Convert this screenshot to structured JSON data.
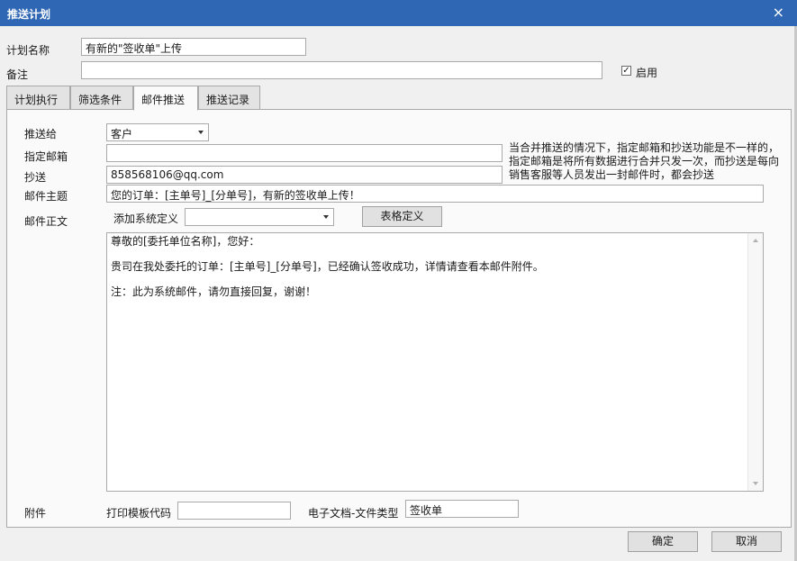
{
  "window": {
    "title": "推送计划",
    "close": "×"
  },
  "plan_name": {
    "label": "计划名称",
    "value": "有新的\"签收单\"上传"
  },
  "remark": {
    "label": "备注",
    "value": ""
  },
  "enable": {
    "label": "启用",
    "checked": true,
    "check_glyph": "✓"
  },
  "tabs": [
    {
      "label": "计划执行"
    },
    {
      "label": "筛选条件"
    },
    {
      "label": "邮件推送"
    },
    {
      "label": "推送记录"
    }
  ],
  "email": {
    "push_to_label": "推送给",
    "push_to_value": "客户",
    "specified_email_label": "指定邮箱",
    "specified_email_value": "",
    "cc_label": "抄送",
    "cc_value": "858568106@qq.com",
    "note_lines": [
      "当合并推送的情况下，指定邮箱和抄送功能是不一样的，",
      "指定邮箱是将所有数据进行合并只发一次，而抄送是每向",
      "销售客服等人员发出一封邮件时，都会抄送"
    ],
    "subject_label": "邮件主题",
    "subject_value": "您的订单：[主单号]_[分单号]，有新的签收单上传！",
    "body_label": "邮件正文",
    "add_system_def_label": "添加系统定义",
    "add_system_def_value": "",
    "table_def_button": "表格定义",
    "body_lines": [
      "尊敬的[委托单位名称]，您好：",
      "贵司在我处委托的订单：[主单号]_[分单号]，已经确认签收成功，详情请查看本邮件附件。",
      "注：此为系统邮件，请勿直接回复，谢谢！"
    ],
    "attachment_label": "附件",
    "print_template_label": "打印模板代码",
    "print_template_value": "",
    "doc_type_label": "电子文档-文件类型",
    "doc_type_value": "签收单"
  },
  "footer": {
    "ok": "确定",
    "cancel": "取消"
  }
}
